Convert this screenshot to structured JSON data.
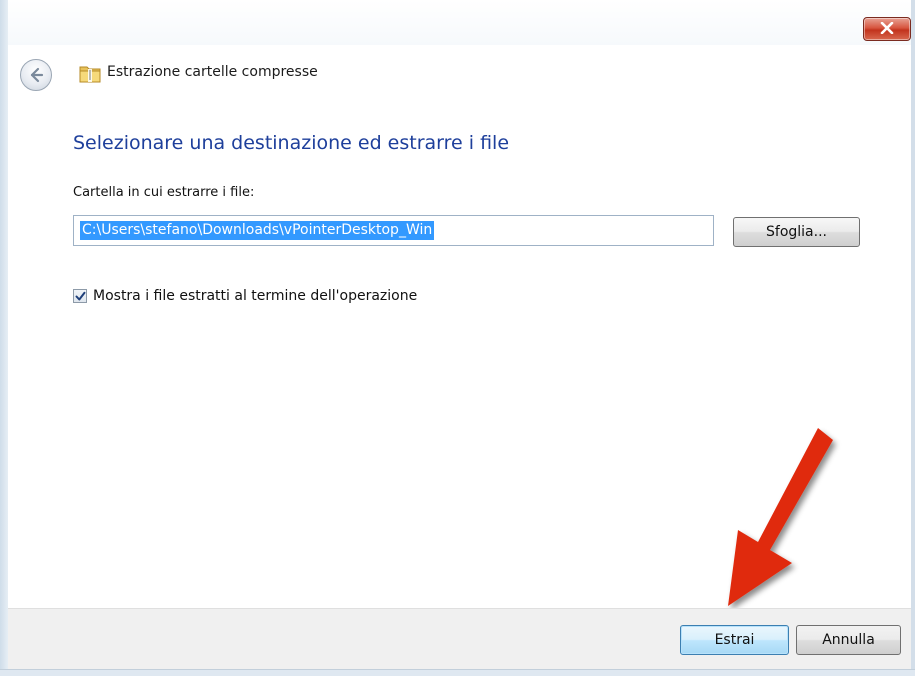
{
  "window": {
    "title": "Estrazione cartelle compresse",
    "close_icon": "close-icon"
  },
  "nav": {
    "back_icon": "back-arrow-icon",
    "folder_icon": "zip-folder-icon"
  },
  "main": {
    "heading": "Selezionare una destinazione ed estrarre i file",
    "field_label": "Cartella in cui estrarre i file:",
    "path_value": "C:\\Users\\stefano\\Downloads\\vPointerDesktop_Win",
    "browse_label": "Sfoglia...",
    "show_files_checked": true,
    "show_files_label": "Mostra i file estratti al termine dell'operazione"
  },
  "footer": {
    "extract_label": "Estrai",
    "cancel_label": "Annulla"
  },
  "colors": {
    "heading": "#1e3f9b",
    "selection": "#3399ff",
    "annotation_arrow": "#e02a10",
    "close_button": "#c2331d"
  }
}
